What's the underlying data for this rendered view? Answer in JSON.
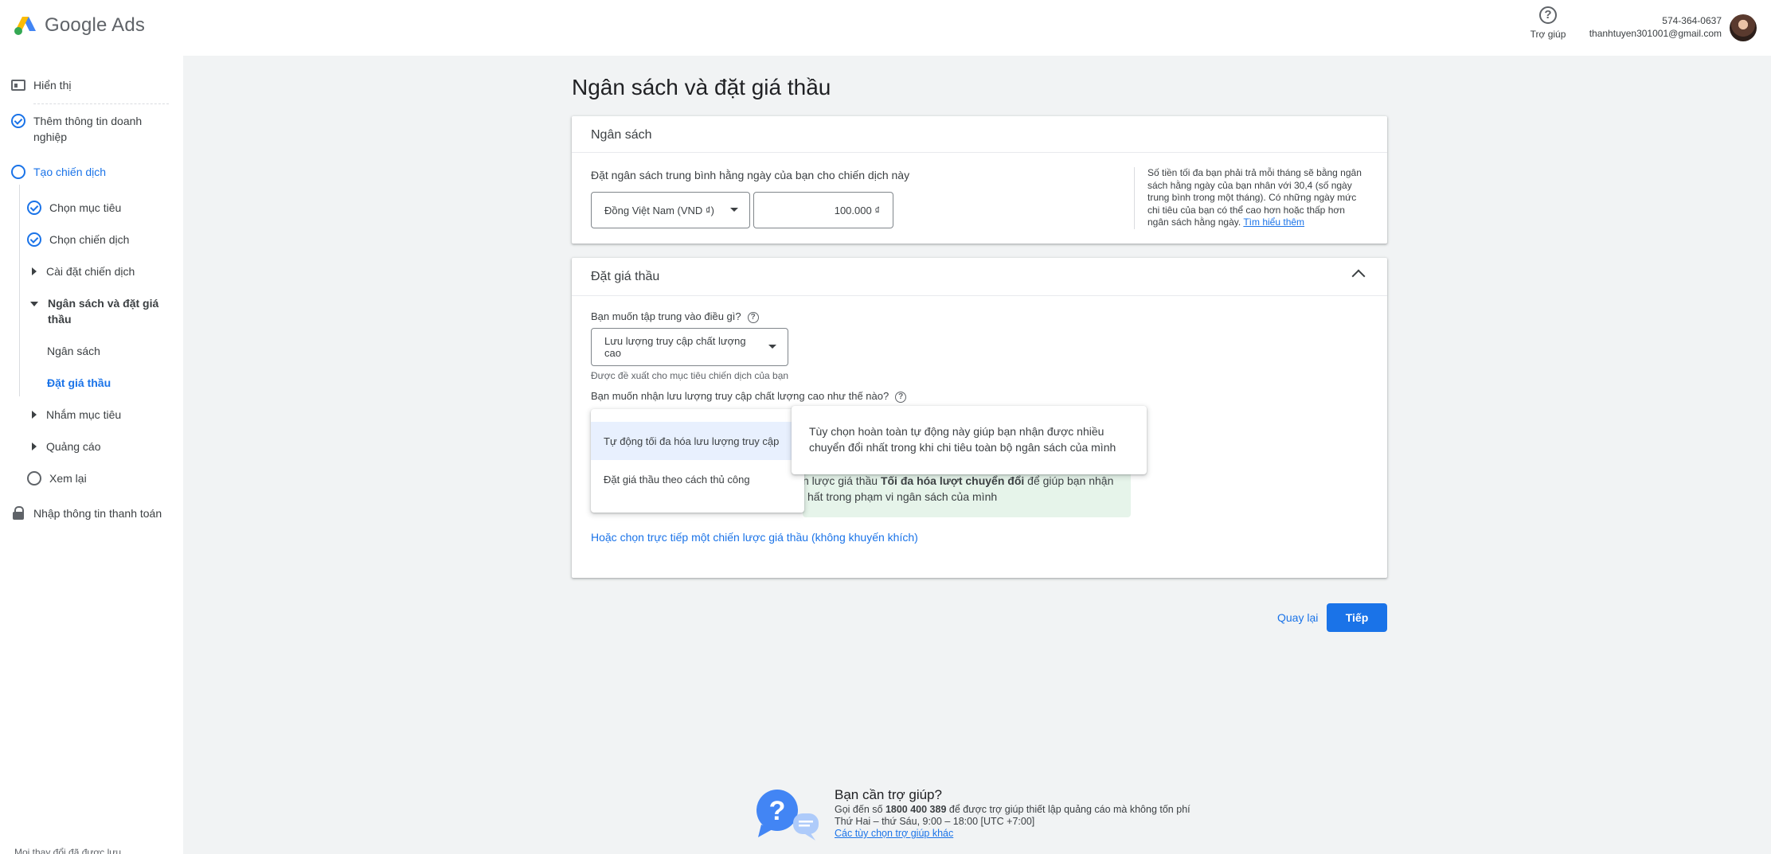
{
  "brand": {
    "name": "Google Ads"
  },
  "header": {
    "help_label": "Trợ giúp",
    "phone": "574-364-0637",
    "email": "thanhtuyen301001@gmail.com"
  },
  "sidebar": {
    "items": [
      {
        "label": "Hiển thị"
      },
      {
        "label": "Thêm thông tin doanh nghiệp"
      },
      {
        "label": "Tạo chiến dịch"
      },
      {
        "label": "Chọn mục tiêu"
      },
      {
        "label": "Chọn chiến dịch"
      },
      {
        "label": "Cài đặt chiến dịch"
      },
      {
        "label": "Ngân sách và đặt giá thầu"
      },
      {
        "label": "Ngân sách"
      },
      {
        "label": "Đặt giá thầu"
      },
      {
        "label": "Nhắm mục tiêu"
      },
      {
        "label": "Quảng cáo"
      },
      {
        "label": "Xem lại"
      },
      {
        "label": "Nhập thông tin thanh toán"
      }
    ],
    "saved_note": "Mọi thay đổi đã được lưu"
  },
  "main": {
    "title": "Ngân sách và đặt giá thầu",
    "budget": {
      "heading": "Ngân sách",
      "prompt": "Đặt ngân sách trung bình hằng ngày của bạn cho chiến dịch này",
      "currency": "Đồng Việt Nam (VND ₫)",
      "amount": "100.000 ₫",
      "info": "Số tiền tối đa bạn phải trả mỗi tháng sẽ bằng ngân sách hằng ngày của bạn nhân với 30,4 (số ngày trung bình trong một tháng). Có những ngày mức chi tiêu của bạn có thể cao hơn hoặc thấp hơn ngân sách hằng ngày.",
      "info_link": "Tìm hiểu thêm"
    },
    "bidding": {
      "heading": "Đặt giá thầu",
      "focus_question": "Bạn muốn tập trung vào điều gì?",
      "focus_value": "Lưu lượng truy cập chất lượng cao",
      "focus_hint": "Được đề xuất cho mục tiêu chiến dịch của bạn",
      "how_question": "Bạn muốn nhận lưu lượng truy cập chất lượng cao như thế nào?",
      "options": [
        "Tự động tối đa hóa lưu lượng truy cập",
        "Đặt giá thầu theo cách thủ công"
      ],
      "tooltip": "Tùy chọn hoàn toàn tự động này giúp bạn nhận được nhiều chuyển đổi nhất trong khi chi tiêu toàn bộ ngân sách của mình",
      "note_prefix": "n lược giá thầu ",
      "note_bold": "Tối đa hóa lượt chuyển đổi",
      "note_suffix": " để giúp bạn nhận",
      "note_line2": "hất trong phạm vi ngân sách của mình",
      "alt_link": "Hoặc chọn trực tiếp một chiến lược giá thầu (không khuyến khích)"
    },
    "back_label": "Quay lại",
    "next_label": "Tiếp"
  },
  "footer": {
    "title": "Bạn cần trợ giúp?",
    "call_prefix": "Gọi đến số ",
    "phone": "1800 400 389",
    "call_suffix": " để được trợ giúp thiết lập quảng cáo mà không tốn phí",
    "hours": "Thứ Hai – thứ Sáu, 9:00 – 18:00 [UTC +7:00]",
    "options_link": "Các tùy chọn trợ giúp khác"
  },
  "colors": {
    "accent": "#1a73e8",
    "success_bg": "#e6f4ea",
    "page_bg": "#f1f3f4"
  },
  "icons": [
    "google-ads-logo",
    "help-icon",
    "avatar",
    "display-icon",
    "check-circle-icon",
    "circle-icon",
    "expand-arrow-icon",
    "collapse-arrow-icon",
    "lock-icon",
    "dropdown-caret-icon",
    "question-icon",
    "chevron-up-icon",
    "support-chat-icon"
  ]
}
